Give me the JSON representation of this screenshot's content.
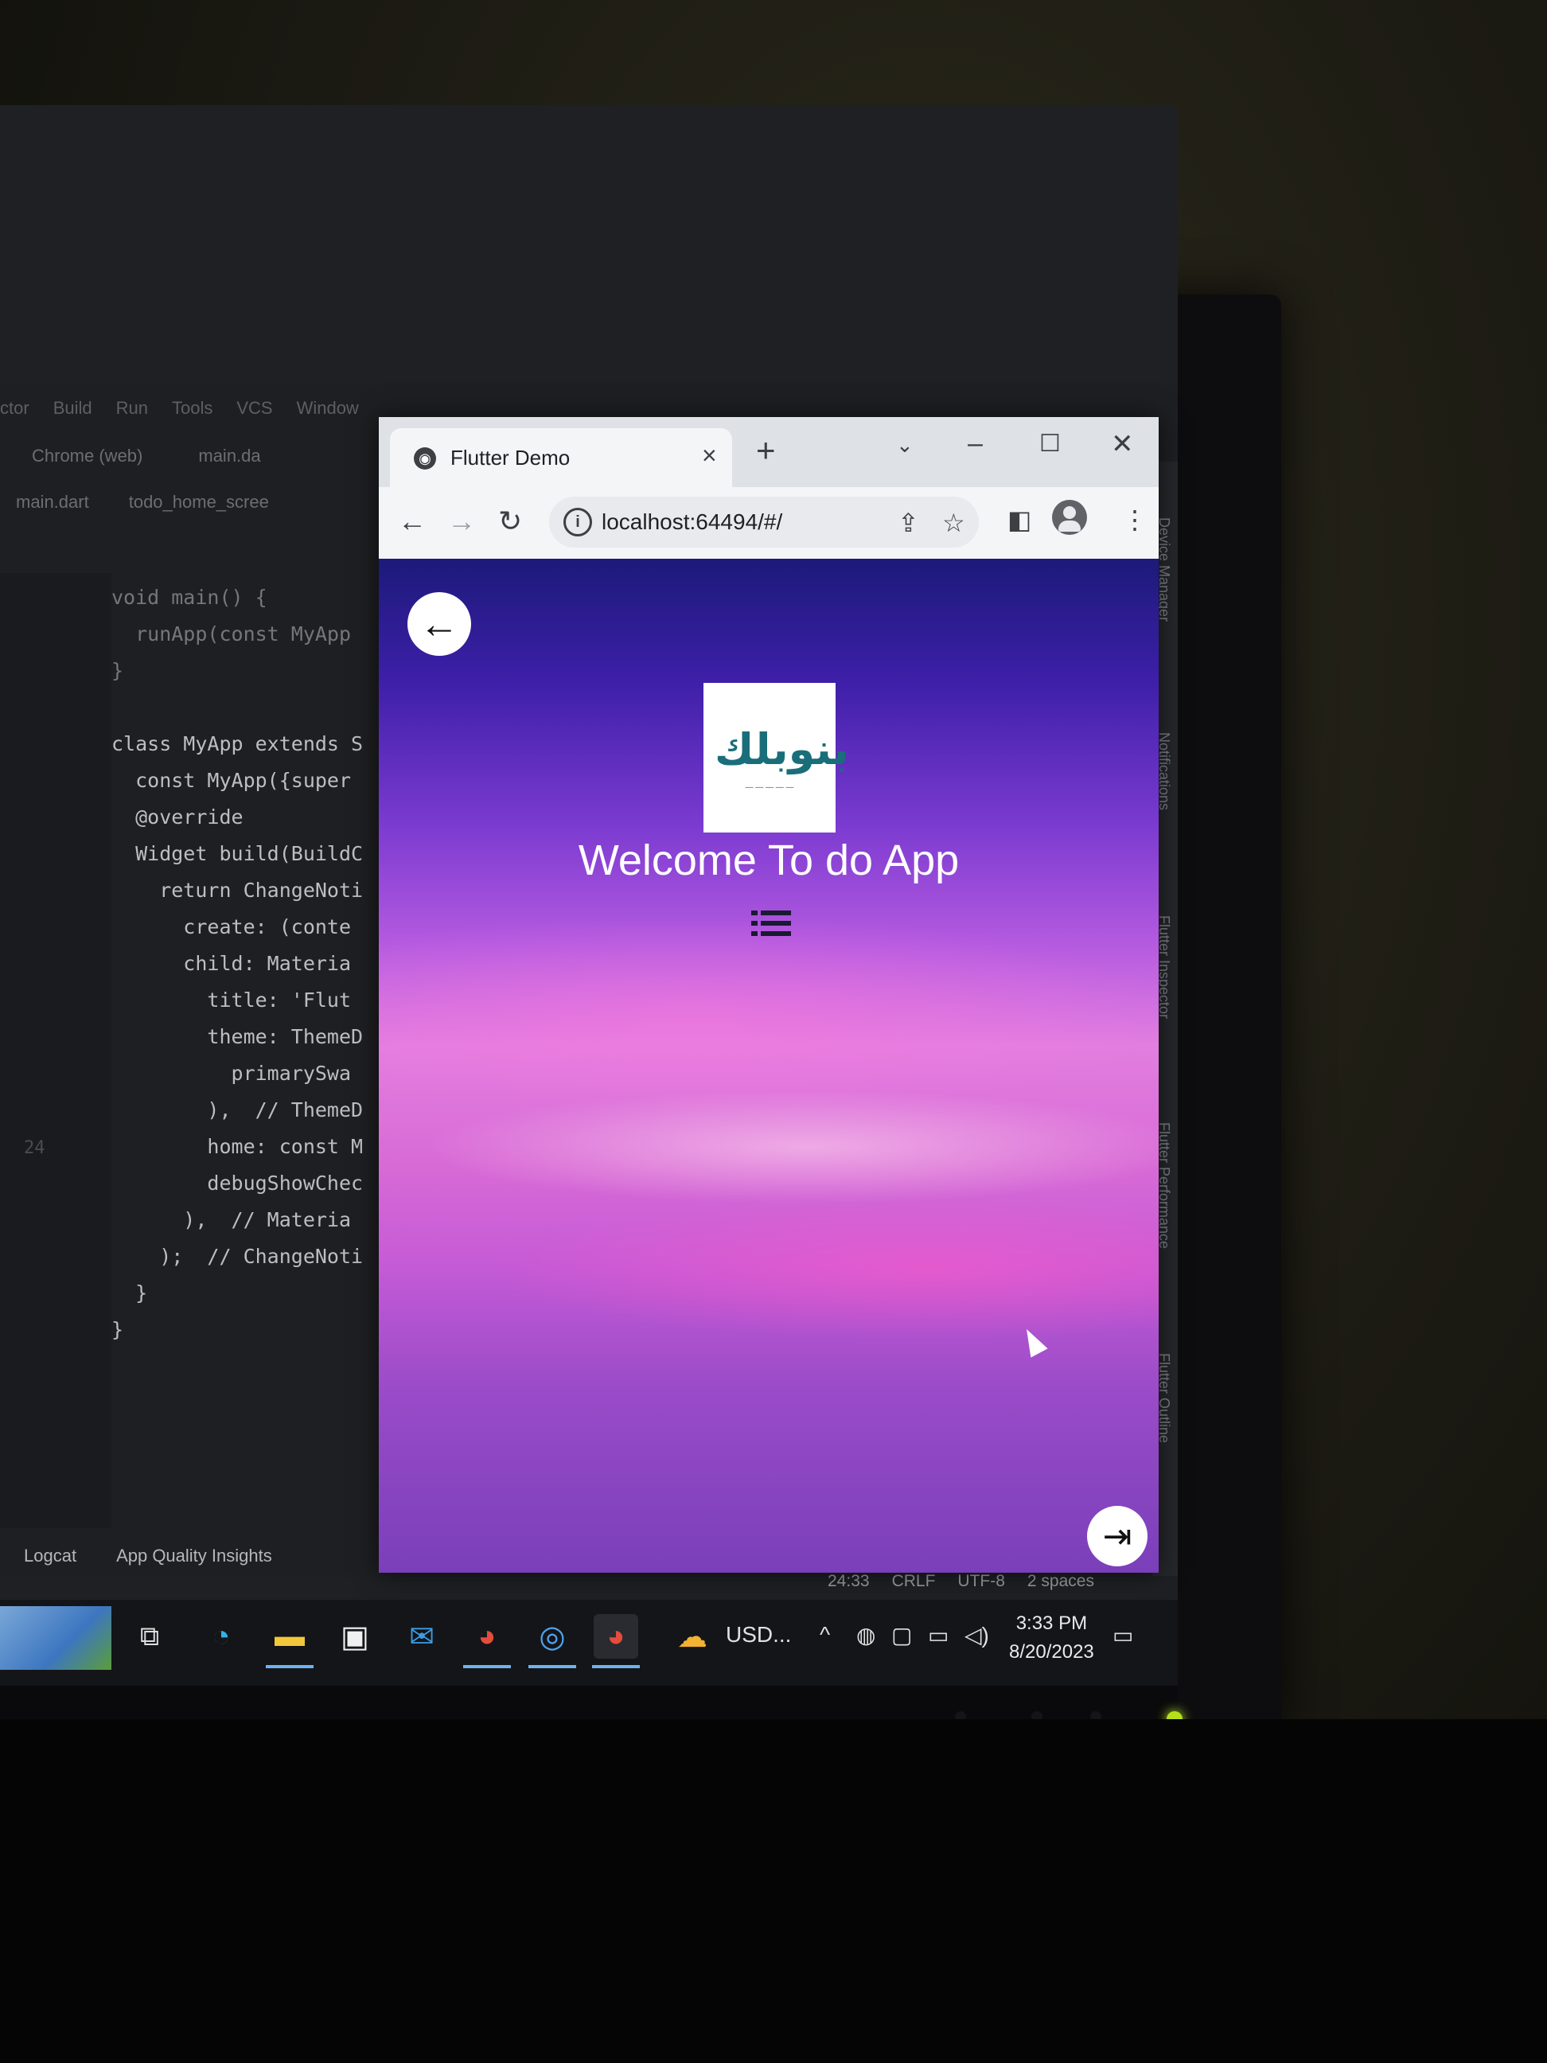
{
  "ide": {
    "menu": [
      "ctor",
      "Build",
      "Run",
      "Tools",
      "VCS",
      "Window"
    ],
    "toolbar": [
      "Chrome (web)",
      "main.da"
    ],
    "file_tabs": [
      "main.dart",
      "todo_home_scree"
    ],
    "code_lines": [
      {
        "num": "",
        "text": "void main() {"
      },
      {
        "num": "",
        "text": "  runApp(const MyApp"
      },
      {
        "num": "",
        "text": "}"
      },
      {
        "num": "",
        "text": ""
      },
      {
        "num": "",
        "text": "class MyApp extends S"
      },
      {
        "num": "",
        "text": "  const MyApp({super"
      },
      {
        "num": "",
        "text": "  @override"
      },
      {
        "num": "",
        "text": "  Widget build(BuildC"
      },
      {
        "num": "",
        "text": "    return ChangeNoti"
      },
      {
        "num": "",
        "text": "      create: (conte"
      },
      {
        "num": "",
        "text": "      child: Materia"
      },
      {
        "num": "",
        "text": "        title: 'Flut"
      },
      {
        "num": "",
        "text": "        theme: ThemeD"
      },
      {
        "num": "",
        "text": "          primarySwa"
      },
      {
        "num": "",
        "text": "        ),  // ThemeD"
      },
      {
        "num": "24",
        "text": "        home: const M"
      },
      {
        "num": "",
        "text": "        debugShowChec"
      },
      {
        "num": "",
        "text": "      ),  // Materia"
      },
      {
        "num": "",
        "text": "    );  // ChangeNoti"
      },
      {
        "num": "",
        "text": "  }"
      },
      {
        "num": "",
        "text": "}"
      }
    ],
    "bottom_tabs": [
      "Logcat",
      "App Quality Insights"
    ],
    "status": [
      "24:33",
      "CRLF",
      "UTF-8",
      "2 spaces"
    ],
    "side_panels": [
      "Device Manager",
      "Notifications",
      "Flutter Inspector",
      "Flutter Performance",
      "Flutter Outline"
    ]
  },
  "browser": {
    "tab_title": "Flutter Demo",
    "url": "localhost:64494/#/"
  },
  "app": {
    "logo_text": "بنوبلك",
    "welcome": "Welcome To do App"
  },
  "taskbar": {
    "weather": "USD...",
    "time": "3:33 PM",
    "date": "8/20/2023"
  },
  "colors": {
    "accent": "#1a73e8",
    "logo_teal": "#1a6e7a",
    "app_gradient_top": "#1c1a7a",
    "app_gradient_mid": "#e27ee0"
  }
}
